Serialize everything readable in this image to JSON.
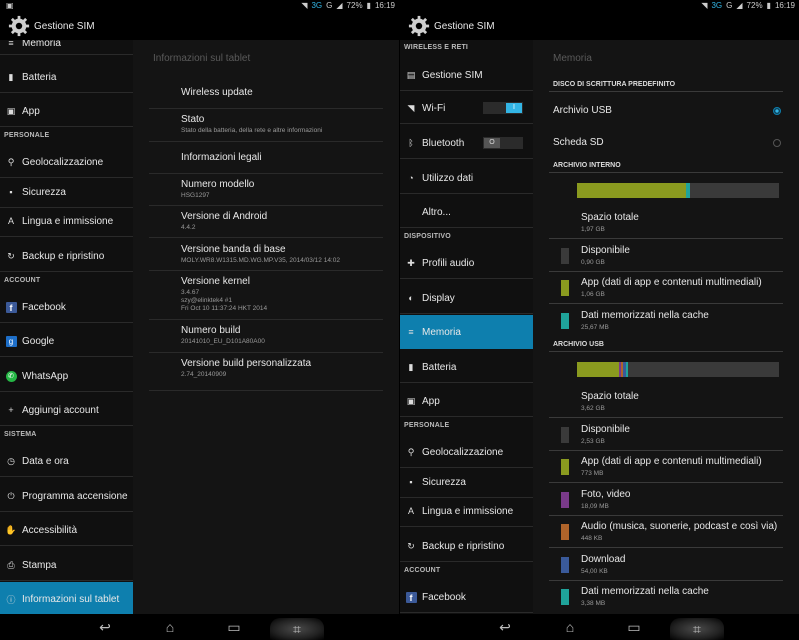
{
  "status": {
    "network": "3G",
    "signal": "G",
    "battery": "72%",
    "time": "16:19"
  },
  "left": {
    "app_title": "Gestione SIM",
    "sidebar": [
      {
        "type": "item",
        "label": "Memoria",
        "icon": "memory-icon"
      },
      {
        "type": "item",
        "label": "Batteria",
        "icon": "battery-icon"
      },
      {
        "type": "item",
        "label": "App",
        "icon": "app-icon"
      },
      {
        "type": "header",
        "label": "PERSONALE"
      },
      {
        "type": "item",
        "label": "Geolocalizzazione",
        "icon": "location-icon"
      },
      {
        "type": "item",
        "label": "Sicurezza",
        "icon": "lock-icon"
      },
      {
        "type": "item",
        "label": "Lingua e immissione",
        "icon": "keyboard-icon"
      },
      {
        "type": "item",
        "label": "Backup e ripristino",
        "icon": "backup-icon"
      },
      {
        "type": "header",
        "label": "ACCOUNT"
      },
      {
        "type": "item",
        "label": "Facebook",
        "icon": "facebook-icon"
      },
      {
        "type": "item",
        "label": "Google",
        "icon": "google-icon"
      },
      {
        "type": "item",
        "label": "WhatsApp",
        "icon": "whatsapp-icon"
      },
      {
        "type": "item",
        "label": "Aggiungi account",
        "icon": "add-icon"
      },
      {
        "type": "header",
        "label": "SISTEMA"
      },
      {
        "type": "item",
        "label": "Data e ora",
        "icon": "clock-icon"
      },
      {
        "type": "item",
        "label": "Programma accensione",
        "icon": "power-icon"
      },
      {
        "type": "item",
        "label": "Accessibilità",
        "icon": "hand-icon"
      },
      {
        "type": "item",
        "label": "Stampa",
        "icon": "print-icon"
      },
      {
        "type": "item",
        "label": "Informazioni sul tablet",
        "icon": "info-icon",
        "active": true
      }
    ],
    "content": {
      "title": "Informazioni sul tablet",
      "rows": [
        {
          "label": "Wireless update",
          "sub": ""
        },
        {
          "label": "Stato",
          "sub": "Stato della batteria, della rete e altre informazioni"
        },
        {
          "label": "Informazioni legali",
          "sub": ""
        },
        {
          "label": "Numero modello",
          "sub": "HSG1297"
        },
        {
          "label": "Versione di Android",
          "sub": "4.4.2"
        },
        {
          "label": "Versione banda di base",
          "sub": "MOLY.WR8.W1315.MD.WG.MP.V35, 2014/03/12 14:02"
        },
        {
          "label": "Versione kernel",
          "sub": "3.4.67\nszy@elinktek4 #1\nFri Oct 10 11:37:24 HKT 2014"
        },
        {
          "label": "Numero build",
          "sub": "20141010_EU_D101A80A00"
        },
        {
          "label": "Versione build personalizzata",
          "sub": "2.74_20140909"
        }
      ]
    }
  },
  "right": {
    "app_title": "Gestione SIM",
    "sidebar": [
      {
        "type": "header",
        "label": "WIRELESS E RETI"
      },
      {
        "type": "item",
        "label": "Gestione SIM",
        "icon": "sim-icon"
      },
      {
        "type": "item",
        "label": "Wi-Fi",
        "icon": "wifi-icon",
        "toggle": "I"
      },
      {
        "type": "item",
        "label": "Bluetooth",
        "icon": "bluetooth-icon",
        "toggle": "O"
      },
      {
        "type": "item",
        "label": "Utilizzo dati",
        "icon": "data-usage-icon"
      },
      {
        "type": "item",
        "label": "Altro...",
        "icon": ""
      },
      {
        "type": "header",
        "label": "DISPOSITIVO"
      },
      {
        "type": "item",
        "label": "Profili audio",
        "icon": "audio-profile-icon"
      },
      {
        "type": "item",
        "label": "Display",
        "icon": "display-icon"
      },
      {
        "type": "item",
        "label": "Memoria",
        "icon": "memory-icon",
        "active": true
      },
      {
        "type": "item",
        "label": "Batteria",
        "icon": "battery-icon"
      },
      {
        "type": "item",
        "label": "App",
        "icon": "app-icon"
      },
      {
        "type": "header",
        "label": "PERSONALE"
      },
      {
        "type": "item",
        "label": "Geolocalizzazione",
        "icon": "location-icon"
      },
      {
        "type": "item",
        "label": "Sicurezza",
        "icon": "lock-icon"
      },
      {
        "type": "item",
        "label": "Lingua e immissione",
        "icon": "keyboard-icon"
      },
      {
        "type": "item",
        "label": "Backup e ripristino",
        "icon": "backup-icon"
      },
      {
        "type": "header",
        "label": "ACCOUNT"
      },
      {
        "type": "item",
        "label": "Facebook",
        "icon": "facebook-icon"
      }
    ],
    "content": {
      "title": "Memoria",
      "default_disk_header": "DISCO DI SCRITTURA PREDEFINITO",
      "options": [
        {
          "label": "Archivio USB",
          "selected": true
        },
        {
          "label": "Scheda SD",
          "selected": false
        }
      ],
      "internal": {
        "header": "ARCHIVIO INTERNO",
        "bar": [
          {
            "color": "#8a9a1f",
            "fraction": 0.54
          },
          {
            "color": "#1fa39a",
            "fraction": 0.02
          }
        ],
        "rows": [
          {
            "label": "Spazio totale",
            "value": "1,97 GB",
            "color": ""
          },
          {
            "label": "Disponibile",
            "value": "0,90 GB",
            "color": "#3a3a3a"
          },
          {
            "label": "App (dati di app e contenuti multimediali)",
            "value": "1,06 GB",
            "color": "#8a9a1f"
          },
          {
            "label": "Dati memorizzati nella cache",
            "value": "25,67 MB",
            "color": "#1fa39a"
          }
        ]
      },
      "usb": {
        "header": "ARCHIVIO USB",
        "bar": [
          {
            "color": "#8a9a1f",
            "fraction": 0.21
          },
          {
            "color": "#7a3a8a",
            "fraction": 0.01
          },
          {
            "color": "#b0642a",
            "fraction": 0.01
          },
          {
            "color": "#3a5a9a",
            "fraction": 0.015
          },
          {
            "color": "#1fa39a",
            "fraction": 0.01
          }
        ],
        "rows": [
          {
            "label": "Spazio totale",
            "value": "3,62 GB",
            "color": ""
          },
          {
            "label": "Disponibile",
            "value": "2,53 GB",
            "color": "#3a3a3a"
          },
          {
            "label": "App (dati di app e contenuti multimediali)",
            "value": "773 MB",
            "color": "#8a9a1f"
          },
          {
            "label": "Foto, video",
            "value": "18,09 MB",
            "color": "#7a3a8a"
          },
          {
            "label": "Audio (musica, suonerie, podcast e così via)",
            "value": "448 KB",
            "color": "#b0642a"
          },
          {
            "label": "Download",
            "value": "54,00 KB",
            "color": "#3a5a9a"
          },
          {
            "label": "Dati memorizzati nella cache",
            "value": "3,38 MB",
            "color": "#1fa39a"
          }
        ]
      }
    }
  }
}
